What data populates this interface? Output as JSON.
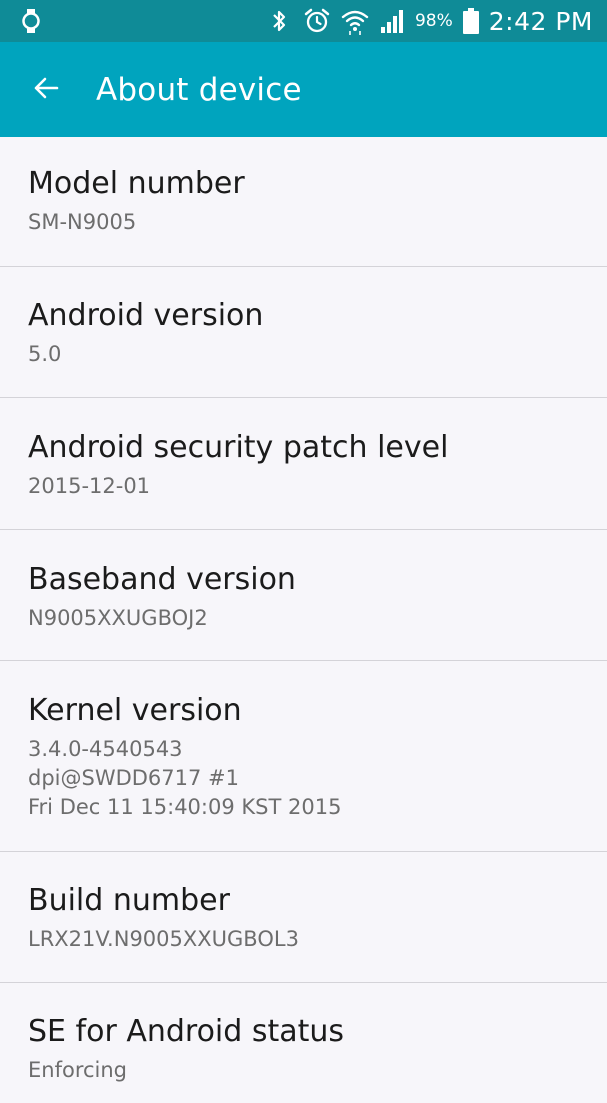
{
  "status_bar": {
    "left_icon": "watch-icon",
    "icons": [
      "bluetooth-icon",
      "alarm-icon",
      "wifi-icon",
      "signal-icon"
    ],
    "battery_percent": "98%",
    "time": "2:42 PM"
  },
  "app_bar": {
    "title": "About device",
    "back_icon": "back-arrow-icon",
    "color": "#00a4be"
  },
  "items": [
    {
      "title": "Model number",
      "lines": [
        "SM-N9005"
      ]
    },
    {
      "title": "Android version",
      "lines": [
        "5.0"
      ]
    },
    {
      "title": "Android security patch level",
      "lines": [
        "2015-12-01"
      ]
    },
    {
      "title": "Baseband version",
      "lines": [
        "N9005XXUGBOJ2"
      ]
    },
    {
      "title": "Kernel version",
      "lines": [
        "3.4.0-4540543",
        "dpi@SWDD6717 #1",
        "Fri Dec 11 15:40:09 KST 2015"
      ]
    },
    {
      "title": "Build number",
      "lines": [
        "LRX21V.N9005XXUGBOL3"
      ]
    },
    {
      "title": "SE for Android status",
      "lines": [
        "Enforcing"
      ]
    }
  ]
}
